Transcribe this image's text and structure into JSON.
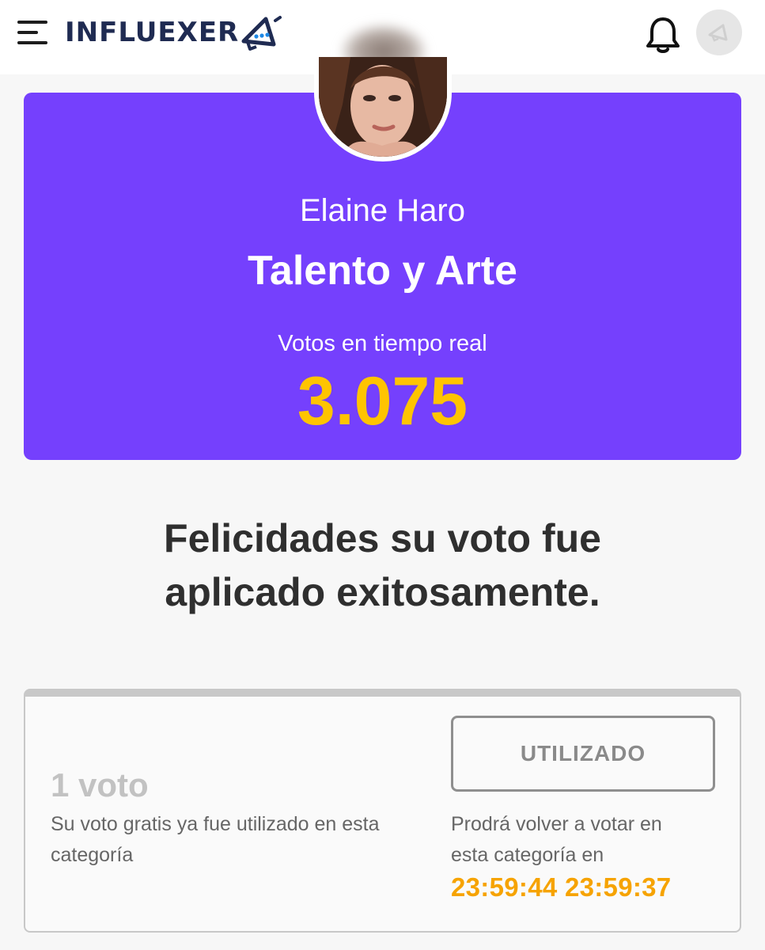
{
  "header": {
    "brand_name": "INFLUEXER",
    "menu_icon": "hamburger-menu-icon",
    "notification_icon": "bell-icon",
    "avatar_icon": "megaphone-icon"
  },
  "profile": {
    "name": "Elaine Haro",
    "category": "Talento y Arte",
    "votes_label": "Votos en tiempo real",
    "votes_count": "3.075"
  },
  "success": {
    "line1": "Felicidades su voto fue",
    "line2": "aplicado exitosamente."
  },
  "vote_card": {
    "amount": "1 voto",
    "description": "Su voto gratis ya fue utilizado en esta categoría",
    "button_label": "UTILIZADO",
    "retry_text": "Prodrá volver a votar en esta categoría en",
    "timer": "23:59:44 23:59:37"
  },
  "colors": {
    "accent_purple": "#7540fd",
    "votes_yellow": "#ffc400",
    "timer_orange": "#f6a300",
    "brand_navy": "#1f2b52"
  }
}
